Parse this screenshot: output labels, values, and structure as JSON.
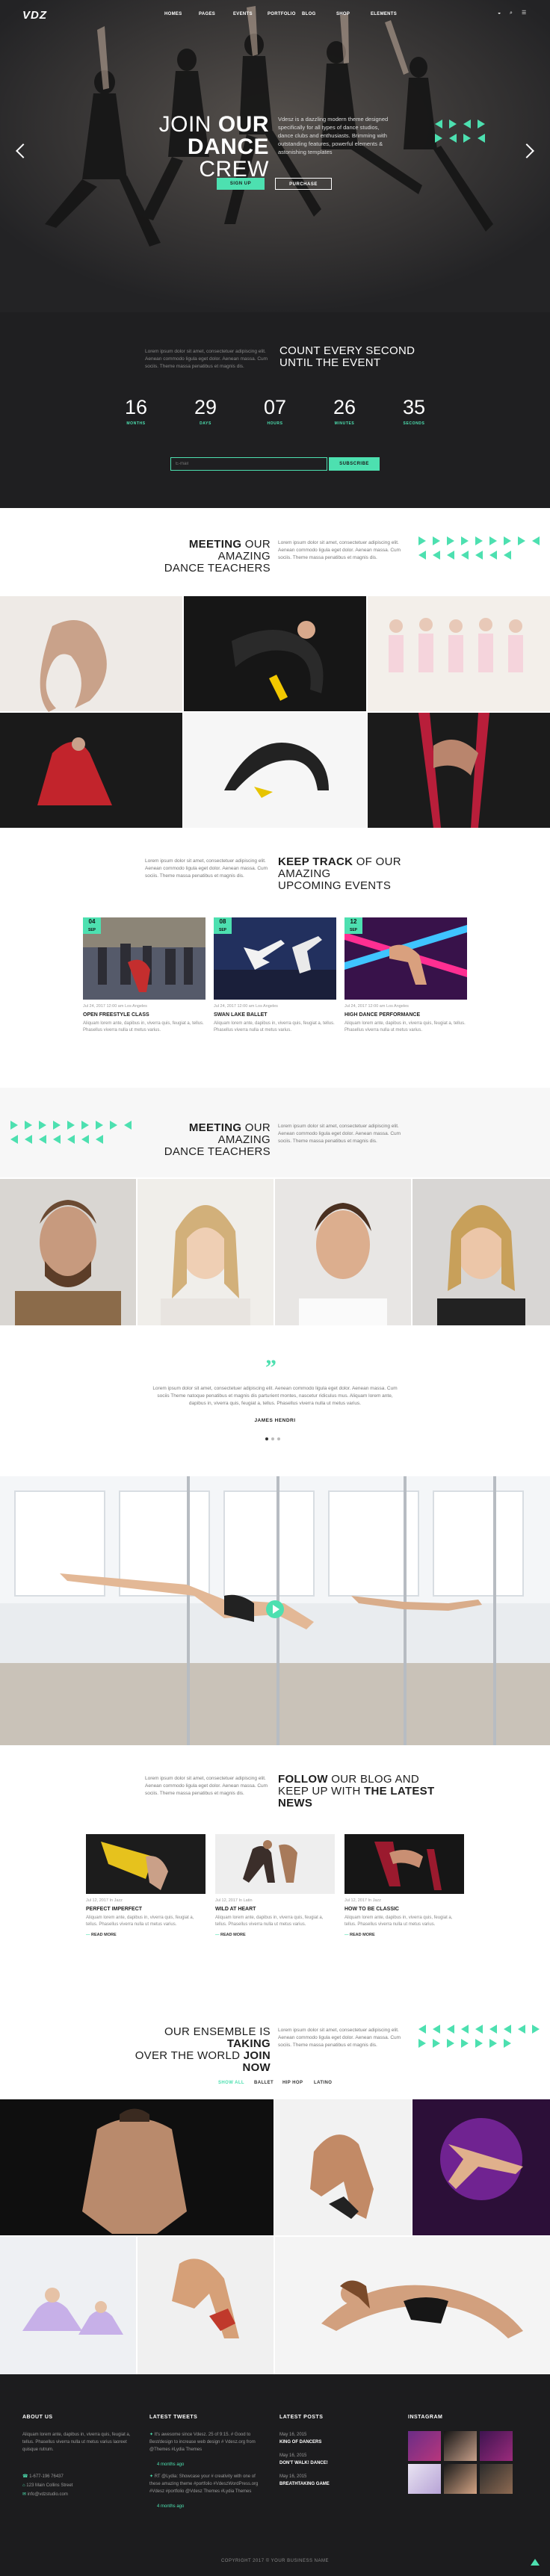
{
  "brand": {
    "logo": "VDZ",
    "accent": "#4de0b0"
  },
  "nav": [
    "HOMES",
    "PAGES",
    "EVENTS",
    "PORTFOLIO",
    "BLOG",
    "SHOP",
    "ELEMENTS"
  ],
  "hero": {
    "title_line1": "JOIN",
    "title_line1_bold": "OUR",
    "title_line2": "DANCE",
    "title_line2_light": "CREW",
    "text": "Vdesz is a dazzling modern theme designed specifically for all types of dance studios, dance clubs and enthusiasts. Brimming with outstanding features, powerful elements & astonishing templates",
    "btn_primary": "SIGN UP",
    "btn_secondary": "PURCHASE"
  },
  "counter": {
    "intro": "Lorem ipsum dolor sit amet, consectetuer adipiscing elit. Aenean commodo ligula eget dolor. Aenean massa. Cum sociis. Theme massa penatibus et magnis dis.",
    "title_line1": "COUNT EVERY SECOND",
    "title_line2": "UNTIL THE EVENT",
    "items": [
      {
        "value": "16",
        "label": "MONTHS"
      },
      {
        "value": "29",
        "label": "DAYS"
      },
      {
        "value": "07",
        "label": "HOURS"
      },
      {
        "value": "26",
        "label": "MINUTES"
      },
      {
        "value": "35",
        "label": "SECONDS"
      }
    ],
    "email_placeholder": "E-mail",
    "subscribe": "SUBSCRIBE"
  },
  "teachers1": {
    "title_a": "MEETING",
    "title_b": "OUR AMAZING",
    "title_c": "DANCE TEACHERS",
    "text": "Lorem ipsum dolor sit amet, consectetuer adipiscing elit. Aenean commodo ligula eget dolor. Aenean massa. Cum sociis. Theme massa penatibus et magnis dis."
  },
  "events": {
    "intro": "Lorem ipsum dolor sit amet, consectetuer adipiscing elit. Aenean commodo ligula eget dolor. Aenean massa. Cum sociis. Theme massa penatibus et magnis dis.",
    "title_a": "KEEP TRACK",
    "title_b": "OF OUR AMAZING",
    "title_c": "UPCOMING EVENTS",
    "items": [
      {
        "date_day": "04",
        "date_mon": "SEP",
        "meta": "Jul 24, 2017   12:00 am   Los Angeles",
        "title": "OPEN FREESTYLE CLASS",
        "text": "Aliquam lorem ante, dapibus in, viverra quis, feugiat a, tellus. Phasellus viverra nulla ut metus varius."
      },
      {
        "date_day": "08",
        "date_mon": "SEP",
        "meta": "Jul 24, 2017   12:00 am   Los Angeles",
        "title": "SWAN LAKE BALLET",
        "text": "Aliquam lorem ante, dapibus in, viverra quis, feugiat a, tellus. Phasellus viverra nulla ut metus varius."
      },
      {
        "date_day": "12",
        "date_mon": "SEP",
        "meta": "Jul 24, 2017   12:00 am   Los Angeles",
        "title": "HIGH DANCE PERFORMANCE",
        "text": "Aliquam lorem ante, dapibus in, viverra quis, feugiat a, tellus. Phasellus viverra nulla ut metus varius."
      }
    ]
  },
  "teachers2": {
    "title_a": "MEETING",
    "title_b": "OUR AMAZING",
    "title_c": "DANCE TEACHERS",
    "text": "Lorem ipsum dolor sit amet, consectetuer adipiscing elit. Aenean commodo ligula eget dolor. Aenean massa. Cum sociis. Theme massa penatibus et magnis dis."
  },
  "testimonial": {
    "quote": "Lorem ipsum dolor sit amet, consectetuer adipiscing elit. Aenean commodo ligula eget dolor. Aenean massa. Cum sociis Theme natoque penatibus et magnis dis parturient montes, nascetur ridiculus mus. Aliquam lorem ante, dapibus in, viverra quis, feugiat a, tellus. Phasellus viverra nulla ut metus varius.",
    "author": "JAMES HENDRI"
  },
  "blog": {
    "intro": "Lorem ipsum dolor sit amet, consectetuer adipiscing elit. Aenean commodo ligula eget dolor. Aenean massa. Cum sociis. Theme massa penatibus et magnis dis.",
    "title_a": "FOLLOW",
    "title_b": "OUR BLOG AND",
    "title_c": "KEEP UP WITH",
    "title_d": "THE LATEST NEWS",
    "items": [
      {
        "meta": "Jul 12, 2017   In Jazz",
        "title": "PERFECT IMPERFECT",
        "text": "Aliquam lorem ante, dapibus in, viverra quis, feugiat a, tellus. Phasellus viverra nulla ut metus varius.",
        "more": "READ MORE"
      },
      {
        "meta": "Jul 12, 2017   In Latin",
        "title": "WILD AT HEART",
        "text": "Aliquam lorem ante, dapibus in, viverra quis, feugiat a, tellus. Phasellus viverra nulla ut metus varius.",
        "more": "READ MORE"
      },
      {
        "meta": "Jul 12, 2017   In Jazz",
        "title": "HOW TO BE CLASSIC",
        "text": "Aliquam lorem ante, dapibus in, viverra quis, feugiat a, tellus. Phasellus viverra nulla ut metus varius.",
        "more": "READ MORE"
      }
    ]
  },
  "ensemble": {
    "title_a": "OUR ENSEMBLE IS",
    "title_b": "TAKING",
    "title_c": "OVER THE WORLD",
    "title_d": "JOIN NOW",
    "text": "Lorem ipsum dolor sit amet, consectetuer adipiscing elit. Aenean commodo ligula eget dolor. Aenean massa. Cum sociis. Theme massa penatibus et magnis dis.",
    "filters": [
      "SHOW ALL",
      "BALLET",
      "HIP HOP",
      "LATINO"
    ]
  },
  "footer": {
    "about_title": "ABOUT US",
    "about_text": "Aliquam lorem ante, dapibus in, viverra quis, feugiat a, tellus. Phasellus viverra nulla ut metus varius laoreet quisque rutrum.",
    "phone": "1-677-196 76437",
    "address": "123 Main Collins Street",
    "email": "info@vdzstudio.com",
    "tweets_title": "LATEST TWEETS",
    "tweet1": "It's awesome since Vdesz. 25 of 9:15. # Good to Best/design to increase web design # Vdesz.org from @Themes #Lydia Themes",
    "tweet1_time": "4 months ago",
    "tweet2": "RT @Lydia: Showcase your # creativity with one of these amazing theme #portfolio #VdeszWordPress.org #Vdesz #portfolio @Vdesz Themes #Lydia Themes",
    "tweet2_time": "4 months ago",
    "posts_title": "LATEST POSTS",
    "posts": [
      {
        "date": "May 16, 2015",
        "title": "KING OF DANCERS"
      },
      {
        "date": "May 16, 2015",
        "title": "DON'T WALK! DANCE!"
      },
      {
        "date": "May 16, 2015",
        "title": "BREATHTAKING GAME"
      }
    ],
    "insta_title": "INSTAGRAM",
    "copyright": "COPYRIGHT 2017 © YOUR BUSINESS NAME"
  }
}
